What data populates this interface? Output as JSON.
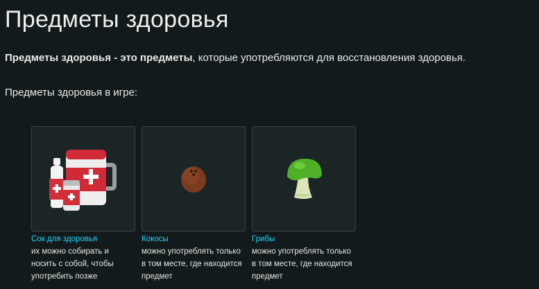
{
  "page": {
    "title": "Предметы здоровья",
    "intro_bold": "Предметы здоровья - это предметы",
    "intro_rest": ", которые употребляются для восстановления здоровья.",
    "subhead": "Предметы здоровья в игре:"
  },
  "items": [
    {
      "name": "Сок для здоровья",
      "icon": "health-juice-icon",
      "desc": "их можно собирать и носить с собой, чтобы употребить позже"
    },
    {
      "name": "Кокосы",
      "icon": "coconut-icon",
      "desc": "можно употреблять только в том месте, где находится предмет"
    },
    {
      "name": "Грибы",
      "icon": "mushroom-icon",
      "desc": "можно употреблять только в том месте, где находится предмет"
    }
  ],
  "colors": {
    "background": "#131a1b",
    "link": "#1fd7ff",
    "card_border": "#3c4547",
    "card_bg": "#1c2526"
  }
}
